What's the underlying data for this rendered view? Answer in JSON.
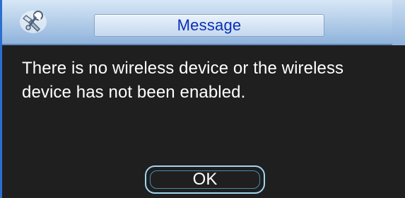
{
  "dialog": {
    "title": "Message",
    "message": "There is no wireless device or the wireless device has not been enabled.",
    "ok_label": "OK",
    "title_icon": "tools-icon"
  },
  "colors": {
    "title_text": "#0a2fb8",
    "body_background": "#1f1f1f",
    "message_text": "#ffffff",
    "button_border": "#9fd6f0"
  }
}
